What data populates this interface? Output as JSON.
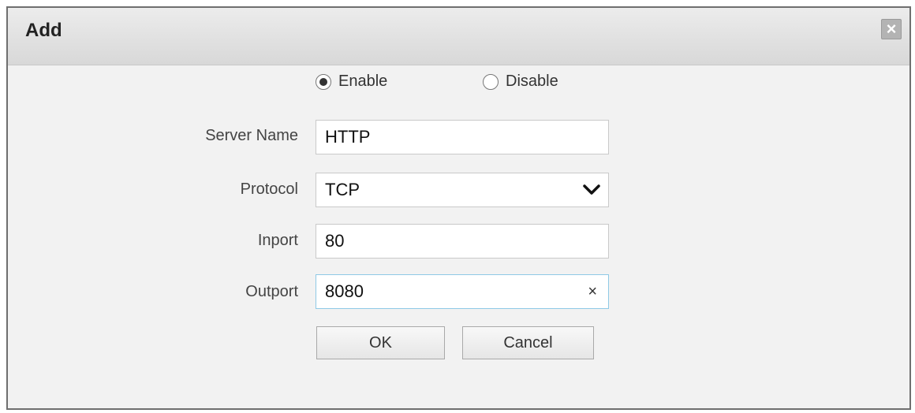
{
  "dialog": {
    "title": "Add",
    "close_icon": "close-icon"
  },
  "status": {
    "enable_label": "Enable",
    "disable_label": "Disable",
    "selected": "Enable"
  },
  "form": {
    "server_name_label": "Server Name",
    "server_name_value": "HTTP",
    "protocol_label": "Protocol",
    "protocol_value": "TCP",
    "inport_label": "Inport",
    "inport_value": "80",
    "outport_label": "Outport",
    "outport_value": "8080",
    "clear_glyph": "×"
  },
  "buttons": {
    "ok_label": "OK",
    "cancel_label": "Cancel"
  }
}
